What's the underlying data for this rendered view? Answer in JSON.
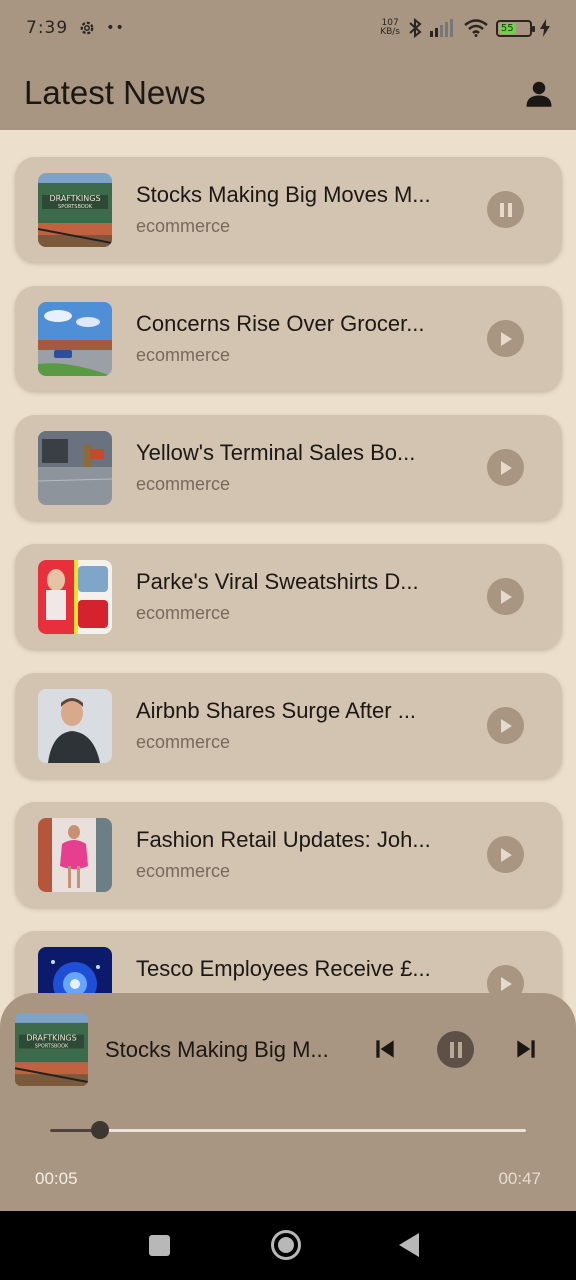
{
  "status_bar": {
    "time": "7:39",
    "net_speed_value": "107",
    "net_speed_unit": "KB/s",
    "battery_level": "55"
  },
  "app_bar": {
    "title": "Latest News",
    "profile_icon": "person-icon"
  },
  "news": [
    {
      "title": "Stocks Making Big Moves M...",
      "category": "ecommerce",
      "state": "pause",
      "thumb": "sportsbook-building"
    },
    {
      "title": "Concerns Rise Over Grocer...",
      "category": "ecommerce",
      "state": "play",
      "thumb": "grocery-parking-lot"
    },
    {
      "title": "Yellow's Terminal Sales Bo...",
      "category": "ecommerce",
      "state": "play",
      "thumb": "truck-terminal"
    },
    {
      "title": "Parke's Viral Sweatshirts D...",
      "category": "ecommerce",
      "state": "play",
      "thumb": "sweatshirts-collage"
    },
    {
      "title": "Airbnb Shares Surge After ...",
      "category": "ecommerce",
      "state": "play",
      "thumb": "man-portrait"
    },
    {
      "title": "Fashion Retail Updates: Joh...",
      "category": "ecommerce",
      "state": "play",
      "thumb": "fashion-pink-dress"
    },
    {
      "title": "Tesco Employees Receive £...",
      "category": "ecommerce",
      "state": "play",
      "thumb": "blue-glow-event"
    }
  ],
  "player": {
    "title": "Stocks Making Big M...",
    "current_time": "00:05",
    "total_time": "00:47",
    "progress": 0.106,
    "thumb": "sportsbook-building"
  },
  "colors": {
    "background": "#ecdfcc",
    "bar": "#a89582",
    "card": "#d3c3b1",
    "accent_dark": "#5d5147"
  }
}
